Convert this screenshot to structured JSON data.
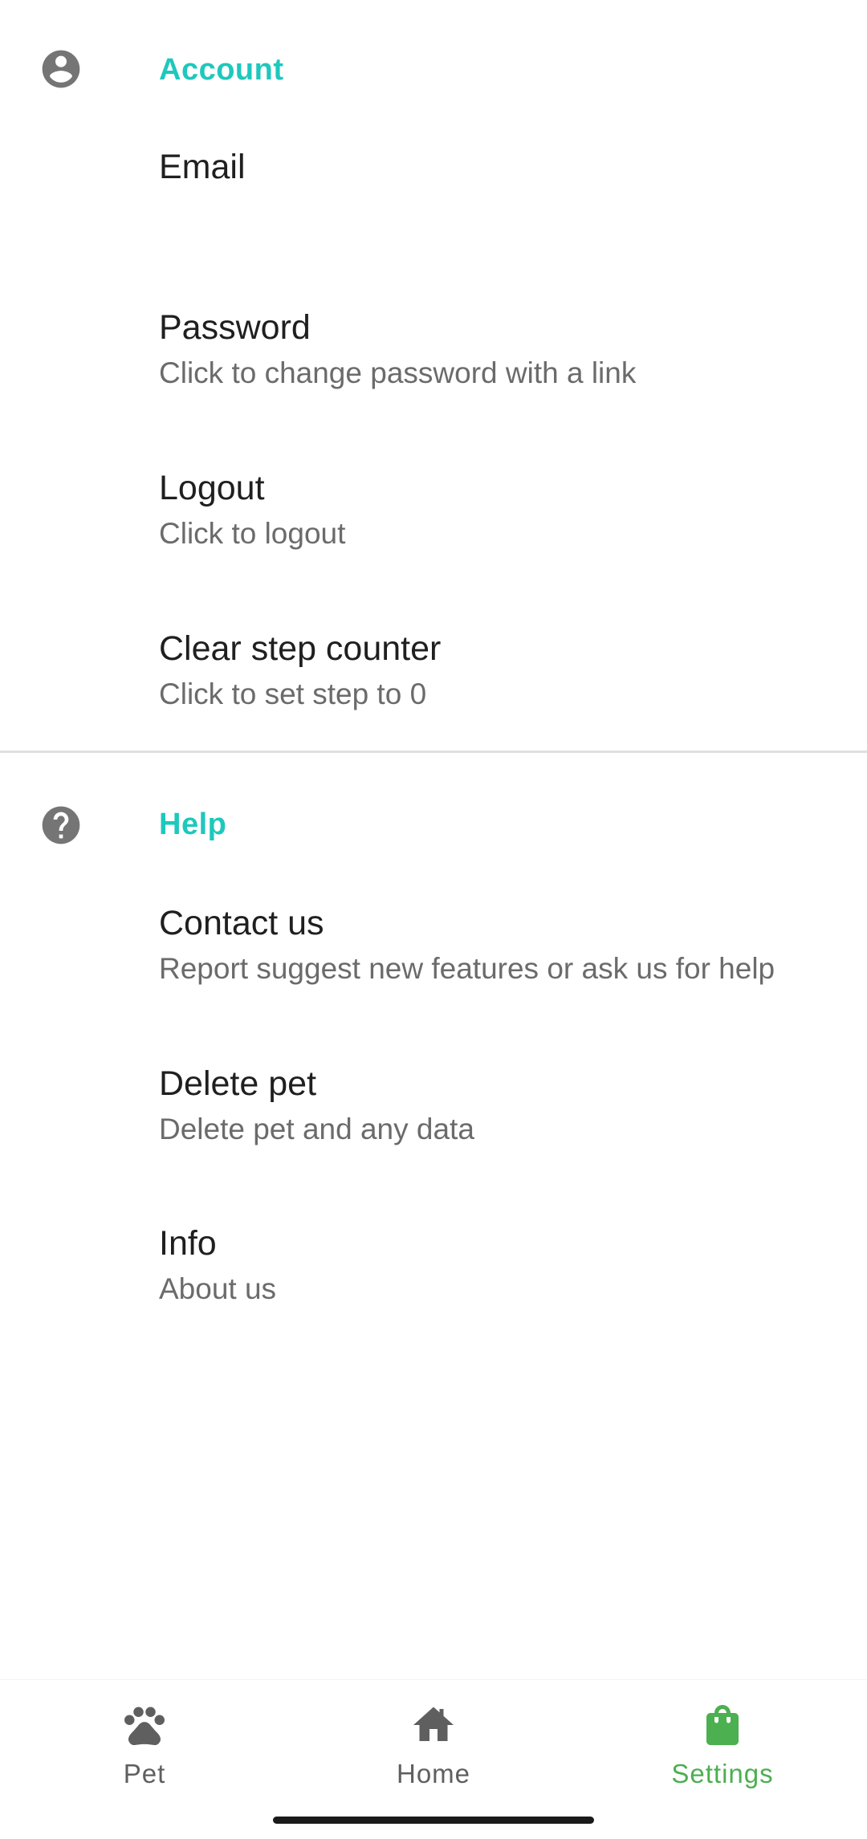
{
  "colors": {
    "category_accent": "#1ec8bd",
    "nav_active": "#4caf50",
    "nav_inactive": "#5f5f5f",
    "icon_gray": "#757575"
  },
  "account": {
    "icon": "account-circle-icon",
    "title": "Account",
    "email": {
      "title": "Email",
      "summary": ""
    },
    "password": {
      "title": "Password",
      "summary": "Click to change password with a link"
    },
    "logout": {
      "title": "Logout",
      "summary": "Click to logout"
    },
    "clear_steps": {
      "title": "Clear step counter",
      "summary": "Click to set step to 0"
    }
  },
  "help": {
    "icon": "help-circle-icon",
    "title": "Help",
    "contact": {
      "title": "Contact us",
      "summary": "Report suggest new features or ask us for help"
    },
    "delete_pet": {
      "title": "Delete pet",
      "summary": "Delete pet and any data"
    },
    "info": {
      "title": "Info",
      "summary": "About us"
    }
  },
  "bottom_nav": {
    "items": [
      {
        "label": "Pet",
        "icon": "paw-icon",
        "active": false
      },
      {
        "label": "Home",
        "icon": "home-icon",
        "active": false
      },
      {
        "label": "Settings",
        "icon": "shopping-bag-icon",
        "active": true
      }
    ]
  }
}
